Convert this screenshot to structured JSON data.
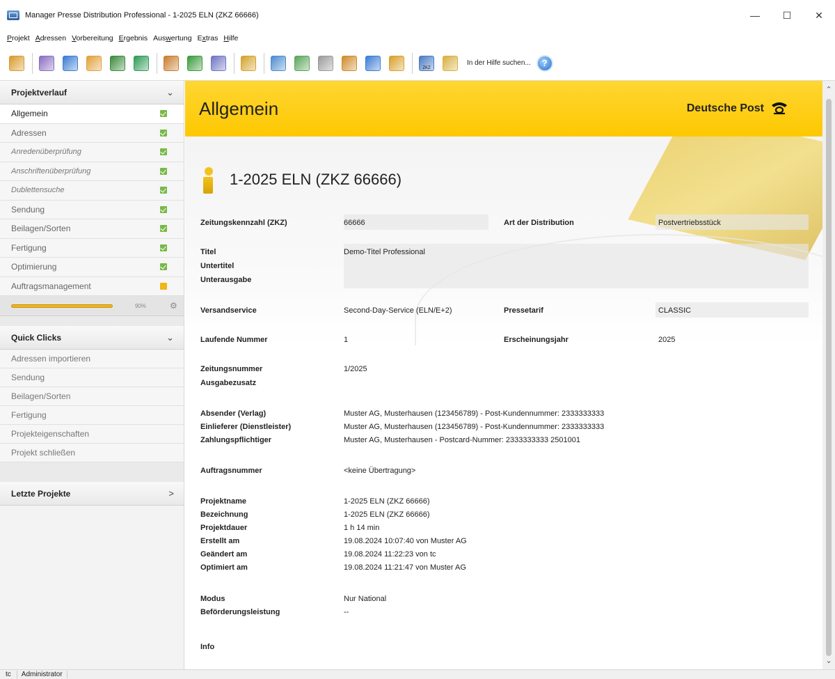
{
  "window": {
    "title": "Manager Presse Distribution Professional - 1-2025 ELN  (ZKZ 66666)",
    "controls": [
      "—",
      "☐",
      "✕"
    ]
  },
  "menu": [
    {
      "prefix": "",
      "u": "P",
      "rest": "rojekt"
    },
    {
      "prefix": "",
      "u": "A",
      "rest": "dressen"
    },
    {
      "prefix": "",
      "u": "V",
      "rest": "orbereitung"
    },
    {
      "prefix": "",
      "u": "E",
      "rest": "rgebnis"
    },
    {
      "prefix": "Aus",
      "u": "w",
      "rest": "ertung"
    },
    {
      "prefix": "E",
      "u": "x",
      "rest": "tras"
    },
    {
      "prefix": "",
      "u": "H",
      "rest": "ilfe"
    }
  ],
  "toolbar": {
    "help_text": "In der Hilfe suchen...",
    "help_icon": "?",
    "icon_colors": [
      "#d89a2a",
      "#8a6cc0",
      "#3b7bd4",
      "#e2a03a",
      "#3a8a3a",
      "#2e9a56",
      "#c97b2c",
      "#3a9a3a",
      "#6f74c4",
      "#d4a22a",
      "#4c8bd0",
      "#5aa55a",
      "#9a9a9a",
      "#cf8a2a",
      "#3b7bd4",
      "#d8a02a",
      "#4a7bc4",
      "#d8b040"
    ],
    "zkz_icon_label": "ZKZ"
  },
  "sidebar": {
    "projektverlauf": {
      "title": "Projektverlauf",
      "items": [
        {
          "label": "Allgemein",
          "status": "ok"
        },
        {
          "label": "Adressen",
          "status": "ok"
        },
        {
          "label": "Anredenüberprüfung",
          "status": "ok"
        },
        {
          "label": "Anschriftenüberprüfung",
          "status": "ok"
        },
        {
          "label": "Dublettensuche",
          "status": "ok"
        },
        {
          "label": "Sendung",
          "status": "ok"
        },
        {
          "label": "Beilagen/Sorten",
          "status": "ok"
        },
        {
          "label": "Fertigung",
          "status": "ok"
        },
        {
          "label": "Optimierung",
          "status": "ok"
        },
        {
          "label": "Auftragsmanagement",
          "status": "warn"
        }
      ],
      "progress_percent": 90,
      "progress_text": "90%"
    },
    "quick_clicks": {
      "title": "Quick Clicks",
      "items": [
        "Adressen importieren",
        "Sendung",
        "Beilagen/Sorten",
        "Fertigung",
        "Projekteigenschaften",
        "Projekt schließen"
      ]
    },
    "letzte_projekte": {
      "title": "Letzte Projekte"
    }
  },
  "main": {
    "page_title": "Allgemein",
    "brand": "Deutsche Post",
    "project_title": "1-2025 ELN (ZKZ 66666)",
    "fields": {
      "zkz": {
        "label": "Zeitungskennzahl (ZKZ)",
        "value": "66666"
      },
      "art": {
        "label": "Art der Distribution",
        "value": "Postvertriebsstück"
      },
      "titel": {
        "label": "Titel",
        "value": "Demo-Titel Professional"
      },
      "untertitel": {
        "label": "Untertitel",
        "value": ""
      },
      "unterausgabe": {
        "label": "Unterausgabe",
        "value": ""
      },
      "versandservice": {
        "label": "Versandservice",
        "value": "Second-Day-Service (ELN/E+2)"
      },
      "pressetarif": {
        "label": "Pressetarif",
        "value": "CLASSIC"
      },
      "laufende_nummer": {
        "label": "Laufende Nummer",
        "value": "1"
      },
      "erscheinungsjahr": {
        "label": "Erscheinungsjahr",
        "value": "2025"
      },
      "zeitungsnummer": {
        "label": "Zeitungsnummer",
        "value": "1/2025"
      },
      "ausgabezusatz": {
        "label": "Ausgabezusatz",
        "value": ""
      },
      "absender": {
        "label": "Absender (Verlag)",
        "value": "Muster AG, Musterhausen (123456789) - Post-Kundennummer: 2333333333"
      },
      "einlieferer": {
        "label": "Einlieferer (Dienstleister)",
        "value": "Muster AG, Musterhausen (123456789) - Post-Kundennummer: 2333333333"
      },
      "zahlungspflichtiger": {
        "label": "Zahlungspflichtiger",
        "value": "Muster AG, Musterhausen - Postcard-Nummer: 2333333333 2501001"
      },
      "auftragsnummer": {
        "label": "Auftragsnummer",
        "value": "<keine Übertragung>"
      },
      "projektname": {
        "label": "Projektname",
        "value": "1-2025 ELN (ZKZ 66666)"
      },
      "bezeichnung": {
        "label": "Bezeichnung",
        "value": "1-2025 ELN (ZKZ 66666)"
      },
      "projektdauer": {
        "label": "Projektdauer",
        "value": "1 h 14 min"
      },
      "erstellt": {
        "label": "Erstellt am",
        "value": "19.08.2024 10:07:40 von Muster AG"
      },
      "geaendert": {
        "label": "Geändert am",
        "value": "19.08.2024 11:22:23 von tc"
      },
      "optimiert": {
        "label": "Optimiert am",
        "value": "19.08.2024 11:21:47 von Muster AG"
      },
      "modus": {
        "label": "Modus",
        "value": "Nur National"
      },
      "befoerderung": {
        "label": "Beförderungsleistung",
        "value": "--"
      },
      "info": {
        "label": "Info",
        "value": ""
      }
    }
  },
  "statusbar": {
    "user": "tc",
    "role": "Administrator"
  },
  "colors": {
    "accent_yellow": "#fdc800",
    "check_green": "#79b84a",
    "warn_orange": "#f0b618"
  }
}
